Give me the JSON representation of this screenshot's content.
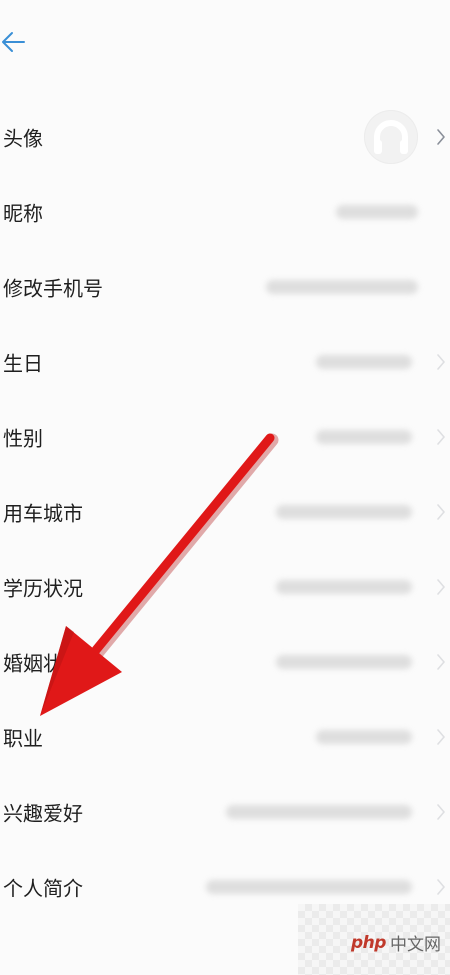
{
  "header": {
    "back_icon": "arrow-left-icon"
  },
  "settings": {
    "rows": [
      {
        "label": "头像",
        "value_type": "avatar"
      },
      {
        "label": "昵称",
        "value_type": "blurred"
      },
      {
        "label": "修改手机号",
        "value_type": "blurred"
      },
      {
        "label": "生日",
        "value_type": "blurred"
      },
      {
        "label": "性别",
        "value_type": "blurred"
      },
      {
        "label": "用车城市",
        "value_type": "blurred"
      },
      {
        "label": "学历状况",
        "value_type": "blurred"
      },
      {
        "label": "婚姻状况",
        "value_type": "blurred"
      },
      {
        "label": "职业",
        "value_type": "blurred"
      },
      {
        "label": "兴趣爱好",
        "value_type": "blurred"
      },
      {
        "label": "个人简介",
        "value_type": "blurred"
      }
    ]
  },
  "watermark": {
    "brand": "php",
    "site": "中文网"
  },
  "colors": {
    "accent": "#3a8fd6",
    "annotation_arrow": "#e01818",
    "background": "#fbfbfb"
  }
}
